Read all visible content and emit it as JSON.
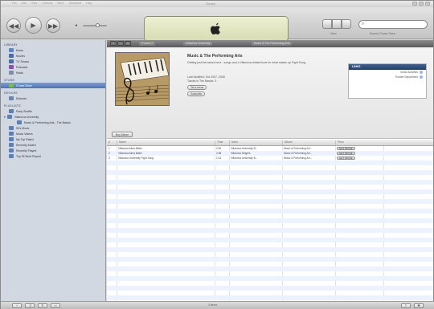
{
  "window": {
    "title": "iTunes",
    "menu": [
      "File",
      "Edit",
      "View",
      "Controls",
      "Store",
      "Advanced",
      "Help"
    ]
  },
  "toolbar": {
    "prev_label": "◀◀",
    "play_label": "▶",
    "next_label": "▶▶",
    "view_label": "View",
    "search_label": "Search iTunes Store",
    "search_placeholder": ""
  },
  "sidebar": {
    "sections": [
      {
        "header": "LIBRARY",
        "items": [
          {
            "label": "Music",
            "icon": "music-note-icon",
            "color": "#5a86c7"
          },
          {
            "label": "Movies",
            "icon": "film-icon",
            "color": "#4a6fa8"
          },
          {
            "label": "TV Shows",
            "icon": "tv-icon",
            "color": "#4a6fa8"
          },
          {
            "label": "Podcasts",
            "icon": "podcast-icon",
            "color": "#8a4fb2"
          },
          {
            "label": "Radio",
            "icon": "radio-antenna-icon",
            "color": "#7b8ea8"
          }
        ]
      },
      {
        "header": "STORE",
        "items": [
          {
            "label": "iTunes Store",
            "icon": "store-icon",
            "color": "#6fbf55",
            "selected": true
          }
        ]
      },
      {
        "header": "DEVICES",
        "items": [
          {
            "label": "Miranda",
            "icon": "ipod-icon",
            "color": "#6d86b0"
          }
        ]
      },
      {
        "header": "PLAYLISTS",
        "items": [
          {
            "label": "Party Shuffle",
            "icon": "party-shuffle-icon",
            "color": "#5d7fb5"
          },
          {
            "label": "Villanova University",
            "icon": "folder-icon",
            "color": "#5d7fb5",
            "expandable": true
          },
          {
            "label": "Music & Performing Arts - The Basics",
            "icon": "playlist-icon",
            "color": "#5d7fb5",
            "level": 2
          },
          {
            "label": "90's Music",
            "icon": "smart-playlist-icon",
            "color": "#5d7fb5"
          },
          {
            "label": "Music Videos",
            "icon": "smart-playlist-icon",
            "color": "#5d7fb5"
          },
          {
            "label": "My Top Rated",
            "icon": "smart-playlist-icon",
            "color": "#5d7fb5"
          },
          {
            "label": "Recently Added",
            "icon": "smart-playlist-icon",
            "color": "#5d7fb5"
          },
          {
            "label": "Recently Played",
            "icon": "smart-playlist-icon",
            "color": "#5d7fb5"
          },
          {
            "label": "Top 25 Most Played",
            "icon": "smart-playlist-icon",
            "color": "#5d7fb5"
          }
        ]
      }
    ]
  },
  "navbar": {
    "crumbs": [
      "iTunes U",
      "Villanova University",
      "Music & The Performing Arts"
    ]
  },
  "store": {
    "title": "Music & The Performing Arts",
    "description": "Getting just the basics here - songs and a Villanova-related tune for what makes up Fight Song.",
    "release_line": "Last Modified: Oct 2007, 2008",
    "tracks_line": "Tracks in The Basics: 3",
    "tell_a_friend": "Tell a friend",
    "subscribe": "Subscribe",
    "buy_all": "Buy Album"
  },
  "links_box": {
    "header": "LINKS",
    "rows": [
      "Music Activities",
      "Theatre Department"
    ]
  },
  "table": {
    "columns": [
      "#",
      "Name",
      "Time",
      "Artist",
      "Album",
      "Price"
    ],
    "rows": [
      {
        "num": "1",
        "name": "Villanova Alma Mater",
        "time": "2:00",
        "artist": "Villanova University B...",
        "album": "Music & Performing Art...",
        "price": "GET MOVIE"
      },
      {
        "num": "2",
        "name": "Villanova Alma Mater",
        "time": "2:38",
        "artist": "Villanova Singers",
        "album": "Music & Performing Art...",
        "price": "GET MOVIE"
      },
      {
        "num": "3",
        "name": "Villanova University Fight Song",
        "time": "1:13",
        "artist": "Villanova University B...",
        "album": "Music & Performing Art...",
        "price": "GET MOVIE"
      }
    ]
  },
  "statusbar": {
    "center_text": "3 items"
  }
}
